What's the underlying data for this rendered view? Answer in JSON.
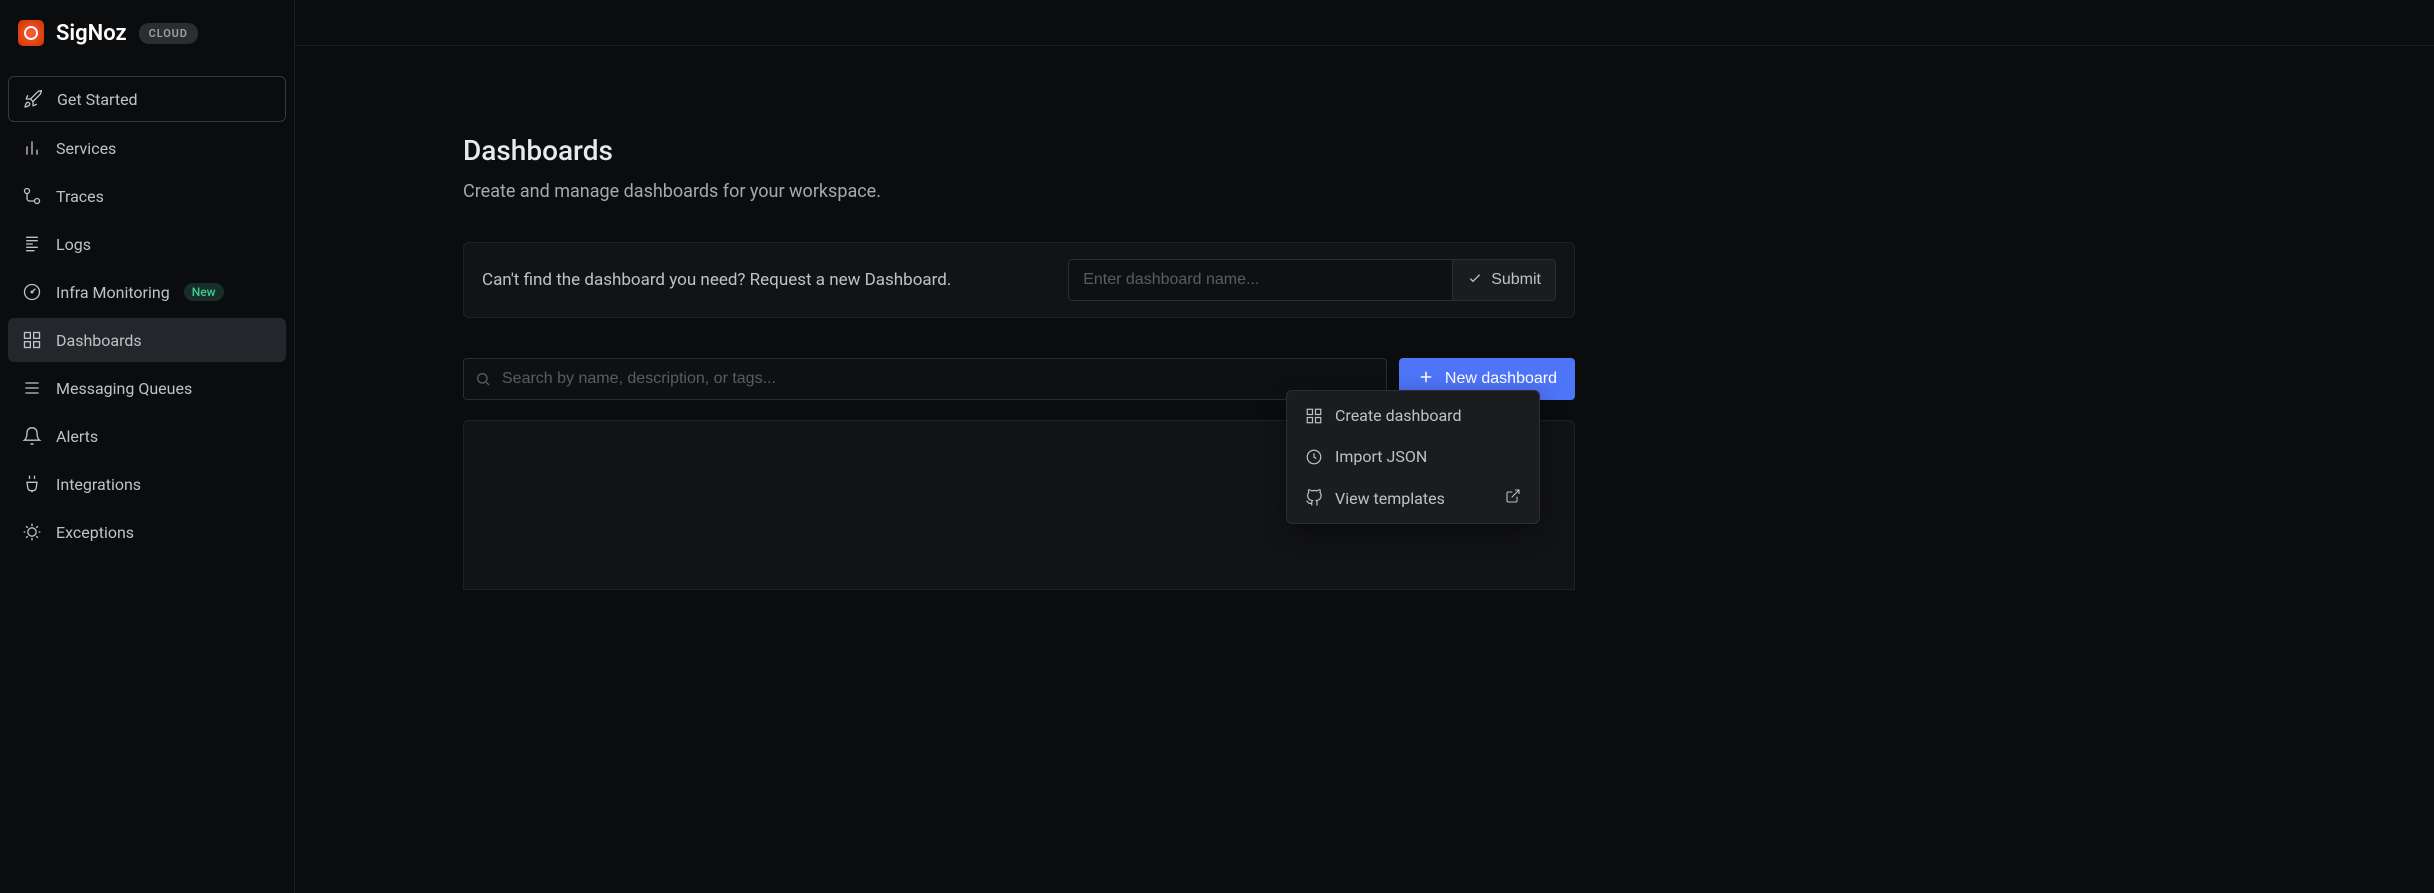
{
  "brand": {
    "name": "SigNoz",
    "badge": "CLOUD"
  },
  "sidebar": {
    "items": [
      {
        "label": "Get Started"
      },
      {
        "label": "Services"
      },
      {
        "label": "Traces"
      },
      {
        "label": "Logs"
      },
      {
        "label": "Infra Monitoring",
        "badge": "New"
      },
      {
        "label": "Dashboards"
      },
      {
        "label": "Messaging Queues"
      },
      {
        "label": "Alerts"
      },
      {
        "label": "Integrations"
      },
      {
        "label": "Exceptions"
      }
    ]
  },
  "page": {
    "title": "Dashboards",
    "subtitle": "Create and manage dashboards for your workspace."
  },
  "request_card": {
    "text": "Can't find the dashboard you need? Request a new Dashboard.",
    "input_placeholder": "Enter dashboard name...",
    "submit_label": "Submit"
  },
  "search": {
    "placeholder": "Search by name, description, or tags..."
  },
  "new_dashboard_button": "New dashboard",
  "dropdown": {
    "create": "Create dashboard",
    "import": "Import JSON",
    "templates": "View templates"
  }
}
